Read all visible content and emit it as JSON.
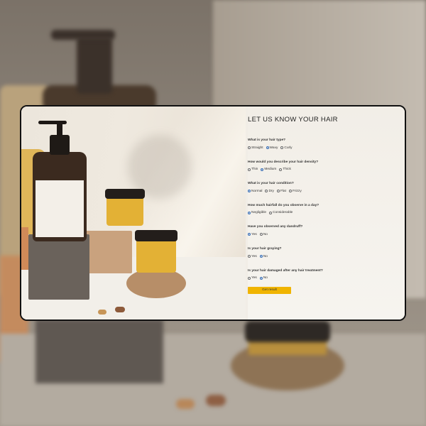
{
  "form": {
    "title": "LET US KNOW YOUR HAIR",
    "questions": [
      {
        "label": "What is your hair type?",
        "options": [
          "Straight",
          "Wavy",
          "Curly"
        ],
        "selected": "Wavy"
      },
      {
        "label": "How would you describe your hair density?",
        "options": [
          "Thin",
          "Medium",
          "Thick"
        ],
        "selected": "Medium"
      },
      {
        "label": "What is your hair condition?",
        "options": [
          "Normal",
          "Dry",
          "Flat",
          "Frizzy"
        ],
        "selected": "Normal"
      },
      {
        "label": "How much hairfall do you observe in a day?",
        "options": [
          "Negligible",
          "Considerable"
        ],
        "selected": "Negligible"
      },
      {
        "label": "Have you observed any dandruff?",
        "options": [
          "Yes",
          "No"
        ],
        "selected": "Yes"
      },
      {
        "label": "Is your hair graying?",
        "options": [
          "Yes",
          "No"
        ],
        "selected": "No"
      },
      {
        "label": "Is your hair damaged after any hair treatment?",
        "options": [
          "Yes",
          "No"
        ],
        "selected": "No"
      }
    ],
    "submit_label": "Get result",
    "accent_color": "#f0b400",
    "radio_color": "#3a6fb5"
  }
}
